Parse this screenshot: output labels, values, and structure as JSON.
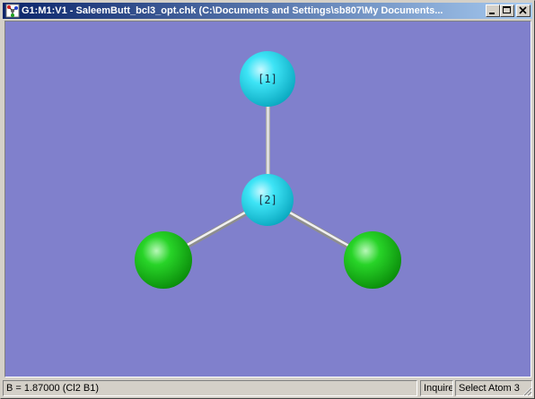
{
  "window": {
    "title": "G1:M1:V1 - SaleemButt_bcl3_opt.chk (C:\\Documents and Settings\\sb807\\My Documents..."
  },
  "colors": {
    "background": "#8080cc",
    "boron_atom": "#22dcf0",
    "chlorine_atom": "#18c818",
    "bond": "#e6e6e6",
    "title_bar_start": "#0a246a",
    "title_bar_end": "#a6caf0"
  },
  "molecule": {
    "atoms": [
      {
        "label": "[1]",
        "element": "B"
      },
      {
        "label": "[2]",
        "element": "B"
      },
      {
        "label": "",
        "element": "Cl"
      },
      {
        "label": "",
        "element": "Cl"
      }
    ]
  },
  "status": {
    "message": "B = 1.87000 (Cl2 B1)",
    "mode": "Inquire",
    "action": "Select Atom 3"
  },
  "icons": {
    "app": "gaussview-molecule-icon",
    "minimize": "minimize-icon",
    "maximize": "maximize-icon",
    "close": "close-icon"
  }
}
